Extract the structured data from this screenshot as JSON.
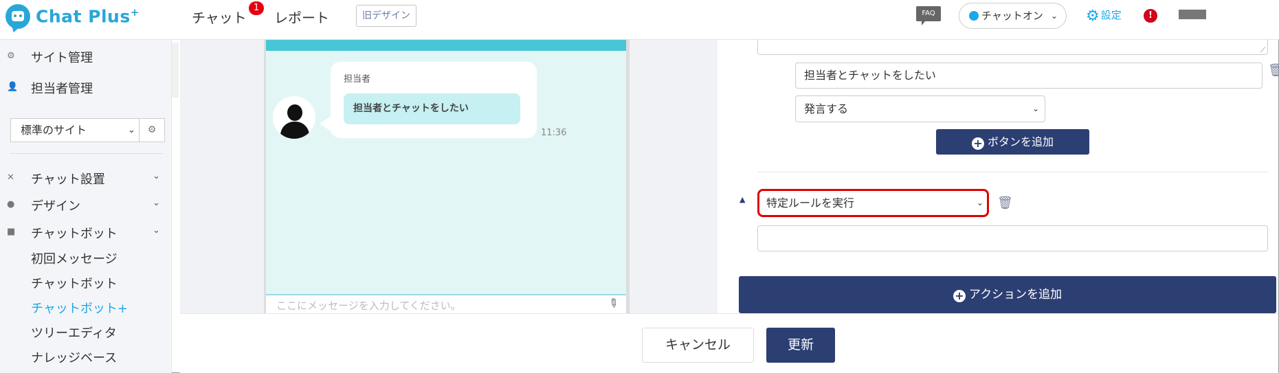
{
  "header": {
    "logo_text": "Chat Plus",
    "logo_sup": "+",
    "nav": {
      "chat_label": "チャット",
      "chat_badge": "1",
      "report_label": "レポート",
      "old_design_label": "旧デザイン"
    },
    "faq_label": "FAQ",
    "chat_status": "チャットオン",
    "settings_label": "設定",
    "alert_label": "!"
  },
  "sidebar": {
    "site_manage": "サイト管理",
    "staff_manage": "担当者管理",
    "site_select_value": "標準のサイト",
    "sections": [
      {
        "label": "チャット設置"
      },
      {
        "label": "デザイン"
      },
      {
        "label": "チャットボット"
      }
    ],
    "chatbot_items": [
      {
        "label": "初回メッセージ"
      },
      {
        "label": "チャットボット"
      },
      {
        "label": "チャットボット+"
      },
      {
        "label": "ツリーエディタ"
      },
      {
        "label": "ナレッジベース"
      }
    ],
    "active_item": "チャットボット+"
  },
  "preview": {
    "sender_name": "担当者",
    "choice_text": "担当者とチャットをしたい",
    "time": "11:36",
    "input_placeholder": "ここにメッセージを入力してください。"
  },
  "editor": {
    "button_text_value": "担当者とチャットをしたい",
    "button_action_value": "発言する",
    "add_button_label": "ボタンを追加",
    "rule_select_value": "特定ルールを実行",
    "add_action_label": "アクションを追加"
  },
  "footer": {
    "cancel_label": "キャンセル",
    "update_label": "更新"
  },
  "colors": {
    "brand": "#28a6d8",
    "primary_button": "#2c3f73",
    "highlight_border": "#e00000",
    "preview_header": "#48c5d6",
    "preview_bg": "#e3f6f6"
  }
}
